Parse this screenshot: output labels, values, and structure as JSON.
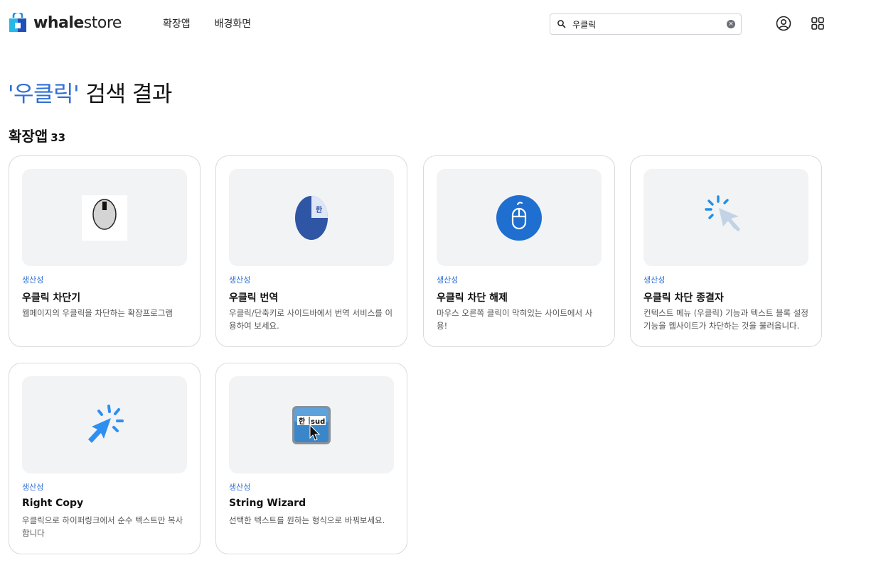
{
  "header": {
    "logo_bold": "whale",
    "logo_light": "store",
    "nav": [
      "확장앱",
      "배경화면"
    ],
    "search_value": "우클릭",
    "clear_label": "×"
  },
  "title": {
    "query": "'우클릭'",
    "suffix": " 검색 결과"
  },
  "section": {
    "label": "확장앱",
    "count": "33"
  },
  "cards": [
    {
      "category": "생산성",
      "name": "우클릭 차단기",
      "desc": "웹페이지의 우클릭을 차단하는 확장프로그램",
      "icon": "mouse-icon"
    },
    {
      "category": "생산성",
      "name": "우클릭 번역",
      "desc": "우클릭/단축키로 사이드바에서 번역 서비스를 이용하여 보세요.",
      "icon": "translate-icon",
      "icon_text": "한"
    },
    {
      "category": "생산성",
      "name": "우클릭 차단 해제",
      "desc": "마우스 오른쪽 클릭이 막혀있는 사이트에서 사용!",
      "icon": "mouse-circle-icon"
    },
    {
      "category": "생산성",
      "name": "우클릭 차단 종결자",
      "desc": "컨텍스트 메뉴 (우클릭) 기능과 텍스트 블록 설정 기능을 웹사이트가 차단하는 것을 불러옵니다.",
      "icon": "cursor-click-icon"
    },
    {
      "category": "생산성",
      "name": "Right Copy",
      "desc": "우클릭으로 하이퍼링크에서 순수 텍스트만 복사합니다",
      "icon": "cursor-click-blue-icon"
    },
    {
      "category": "생산성",
      "name": "String Wizard",
      "desc": "선택한 텍스트를 원하는 형식으로 바꿔보세요.",
      "icon": "string-wizard-icon",
      "icon_text_a": "한",
      "icon_text_b": "sud"
    }
  ],
  "colors": {
    "accent": "#2f6fd6",
    "thumb_bg": "#f1f3f5",
    "card_border": "#d7dadd"
  }
}
